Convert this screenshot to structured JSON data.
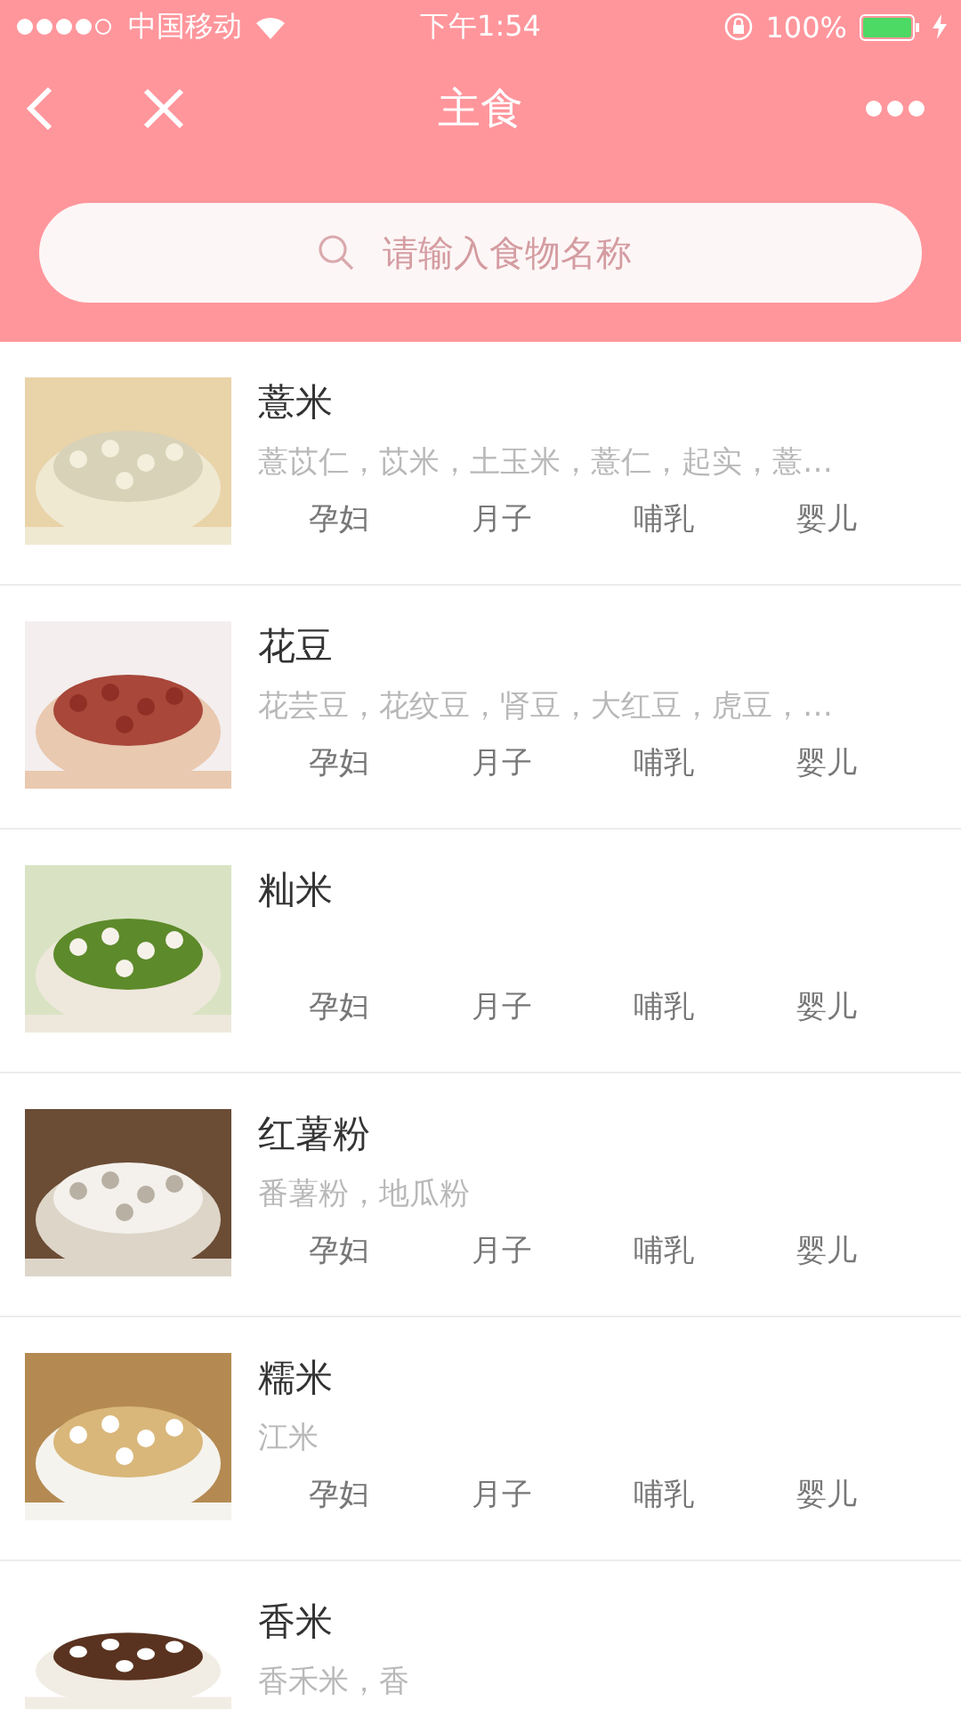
{
  "status_bar": {
    "carrier": "中国移动",
    "time": "下午1:54",
    "battery": "100%"
  },
  "nav": {
    "title": "主食"
  },
  "search": {
    "placeholder": "请输入食物名称"
  },
  "foods": [
    {
      "name": "薏米",
      "aliases": "薏苡仁，苡米，土玉米，薏仁，起实，薏…",
      "tags": [
        "孕妇",
        "月子",
        "哺乳",
        "婴儿"
      ]
    },
    {
      "name": "花豆",
      "aliases": "花芸豆，花纹豆，肾豆，大红豆，虎豆，…",
      "tags": [
        "孕妇",
        "月子",
        "哺乳",
        "婴儿"
      ]
    },
    {
      "name": "籼米",
      "tags": [
        "孕妇",
        "月子",
        "哺乳",
        "婴儿"
      ]
    },
    {
      "name": "红薯粉",
      "aliases": "番薯粉，地瓜粉",
      "tags": [
        "孕妇",
        "月子",
        "哺乳",
        "婴儿"
      ]
    },
    {
      "name": "糯米",
      "aliases": "江米",
      "tags": [
        "孕妇",
        "月子",
        "哺乳",
        "婴儿"
      ]
    },
    {
      "name": "香米",
      "aliases": "香禾米，香"
    }
  ]
}
